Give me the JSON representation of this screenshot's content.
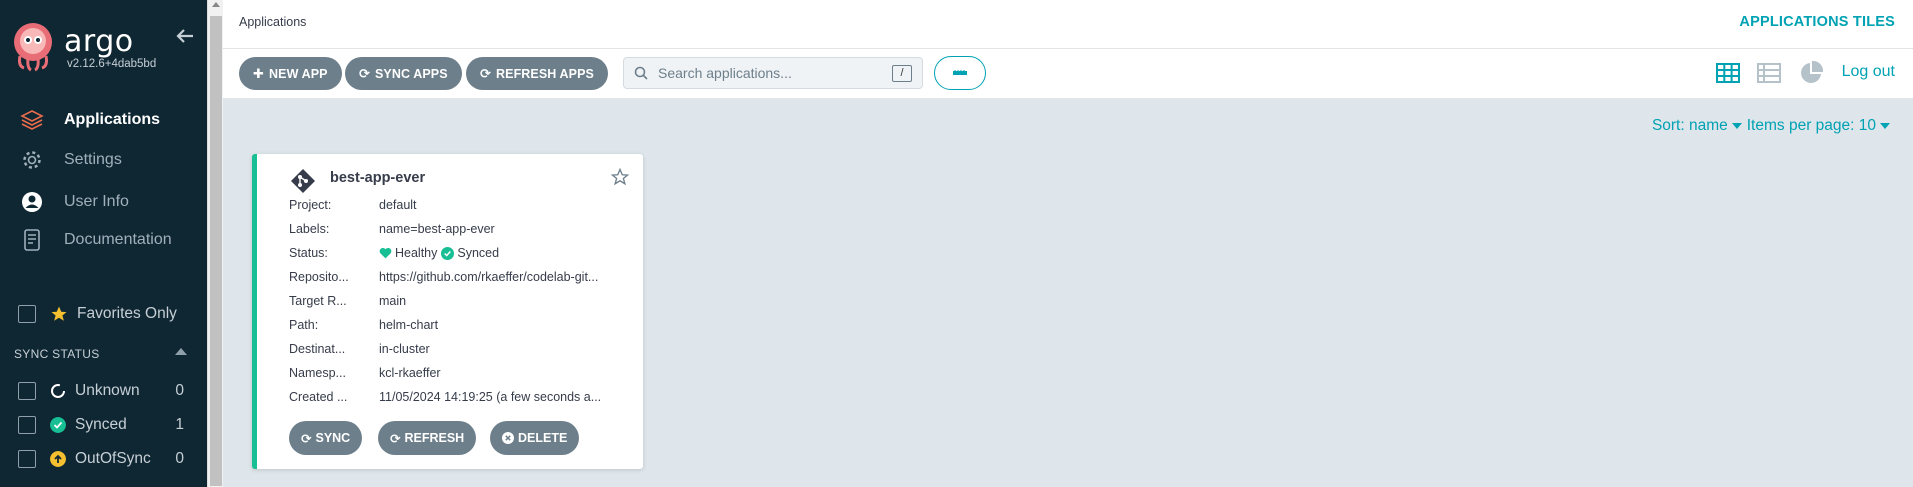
{
  "sidebar": {
    "brand": "argo",
    "version": "v2.12.6+4dab5bd",
    "nav": [
      {
        "label": "Applications",
        "icon": "layers-icon",
        "active": true
      },
      {
        "label": "Settings",
        "icon": "gear-icon",
        "active": false
      },
      {
        "label": "User Info",
        "icon": "user-icon",
        "active": false
      },
      {
        "label": "Documentation",
        "icon": "document-icon",
        "active": false
      }
    ],
    "favorites_label": "Favorites Only",
    "sync_status_heading": "SYNC STATUS",
    "sync_status": [
      {
        "label": "Unknown",
        "count": "0",
        "color": "#ffffff"
      },
      {
        "label": "Synced",
        "count": "1",
        "color": "#18be94"
      },
      {
        "label": "OutOfSync",
        "count": "0",
        "color": "#f4c030"
      }
    ]
  },
  "header": {
    "breadcrumb": "Applications",
    "view_title": "APPLICATIONS TILES",
    "logout": "Log out"
  },
  "toolbar": {
    "new_app": "NEW APP",
    "sync_apps": "SYNC APPS",
    "refresh_apps": "REFRESH APPS",
    "search_placeholder": "Search applications...",
    "search_shortcut": "/"
  },
  "sort": {
    "sort_label": "Sort: name",
    "per_page_label": "Items per page: 10"
  },
  "app_card": {
    "name": "best-app-ever",
    "fields": [
      {
        "key": "Project:",
        "value": "default"
      },
      {
        "key": "Labels:",
        "value": "name=best-app-ever"
      },
      {
        "key": "Status:",
        "health": "Healthy",
        "sync": "Synced"
      },
      {
        "key": "Reposito...",
        "value": "https://github.com/rkaeffer/codelab-git..."
      },
      {
        "key": "Target R...",
        "value": "main"
      },
      {
        "key": "Path:",
        "value": "helm-chart"
      },
      {
        "key": "Destinat...",
        "value": "in-cluster"
      },
      {
        "key": "Namesp...",
        "value": "kcl-rkaeffer"
      },
      {
        "key": "Created ...",
        "value": "11/05/2024 14:19:25  (a few seconds a..."
      }
    ],
    "actions": {
      "sync": "SYNC",
      "refresh": "REFRESH",
      "delete": "DELETE"
    }
  },
  "colors": {
    "sidebar_bg": "#0f2733",
    "accent": "#00a2b3",
    "healthy": "#18be94",
    "button": "#6d7f8b"
  }
}
